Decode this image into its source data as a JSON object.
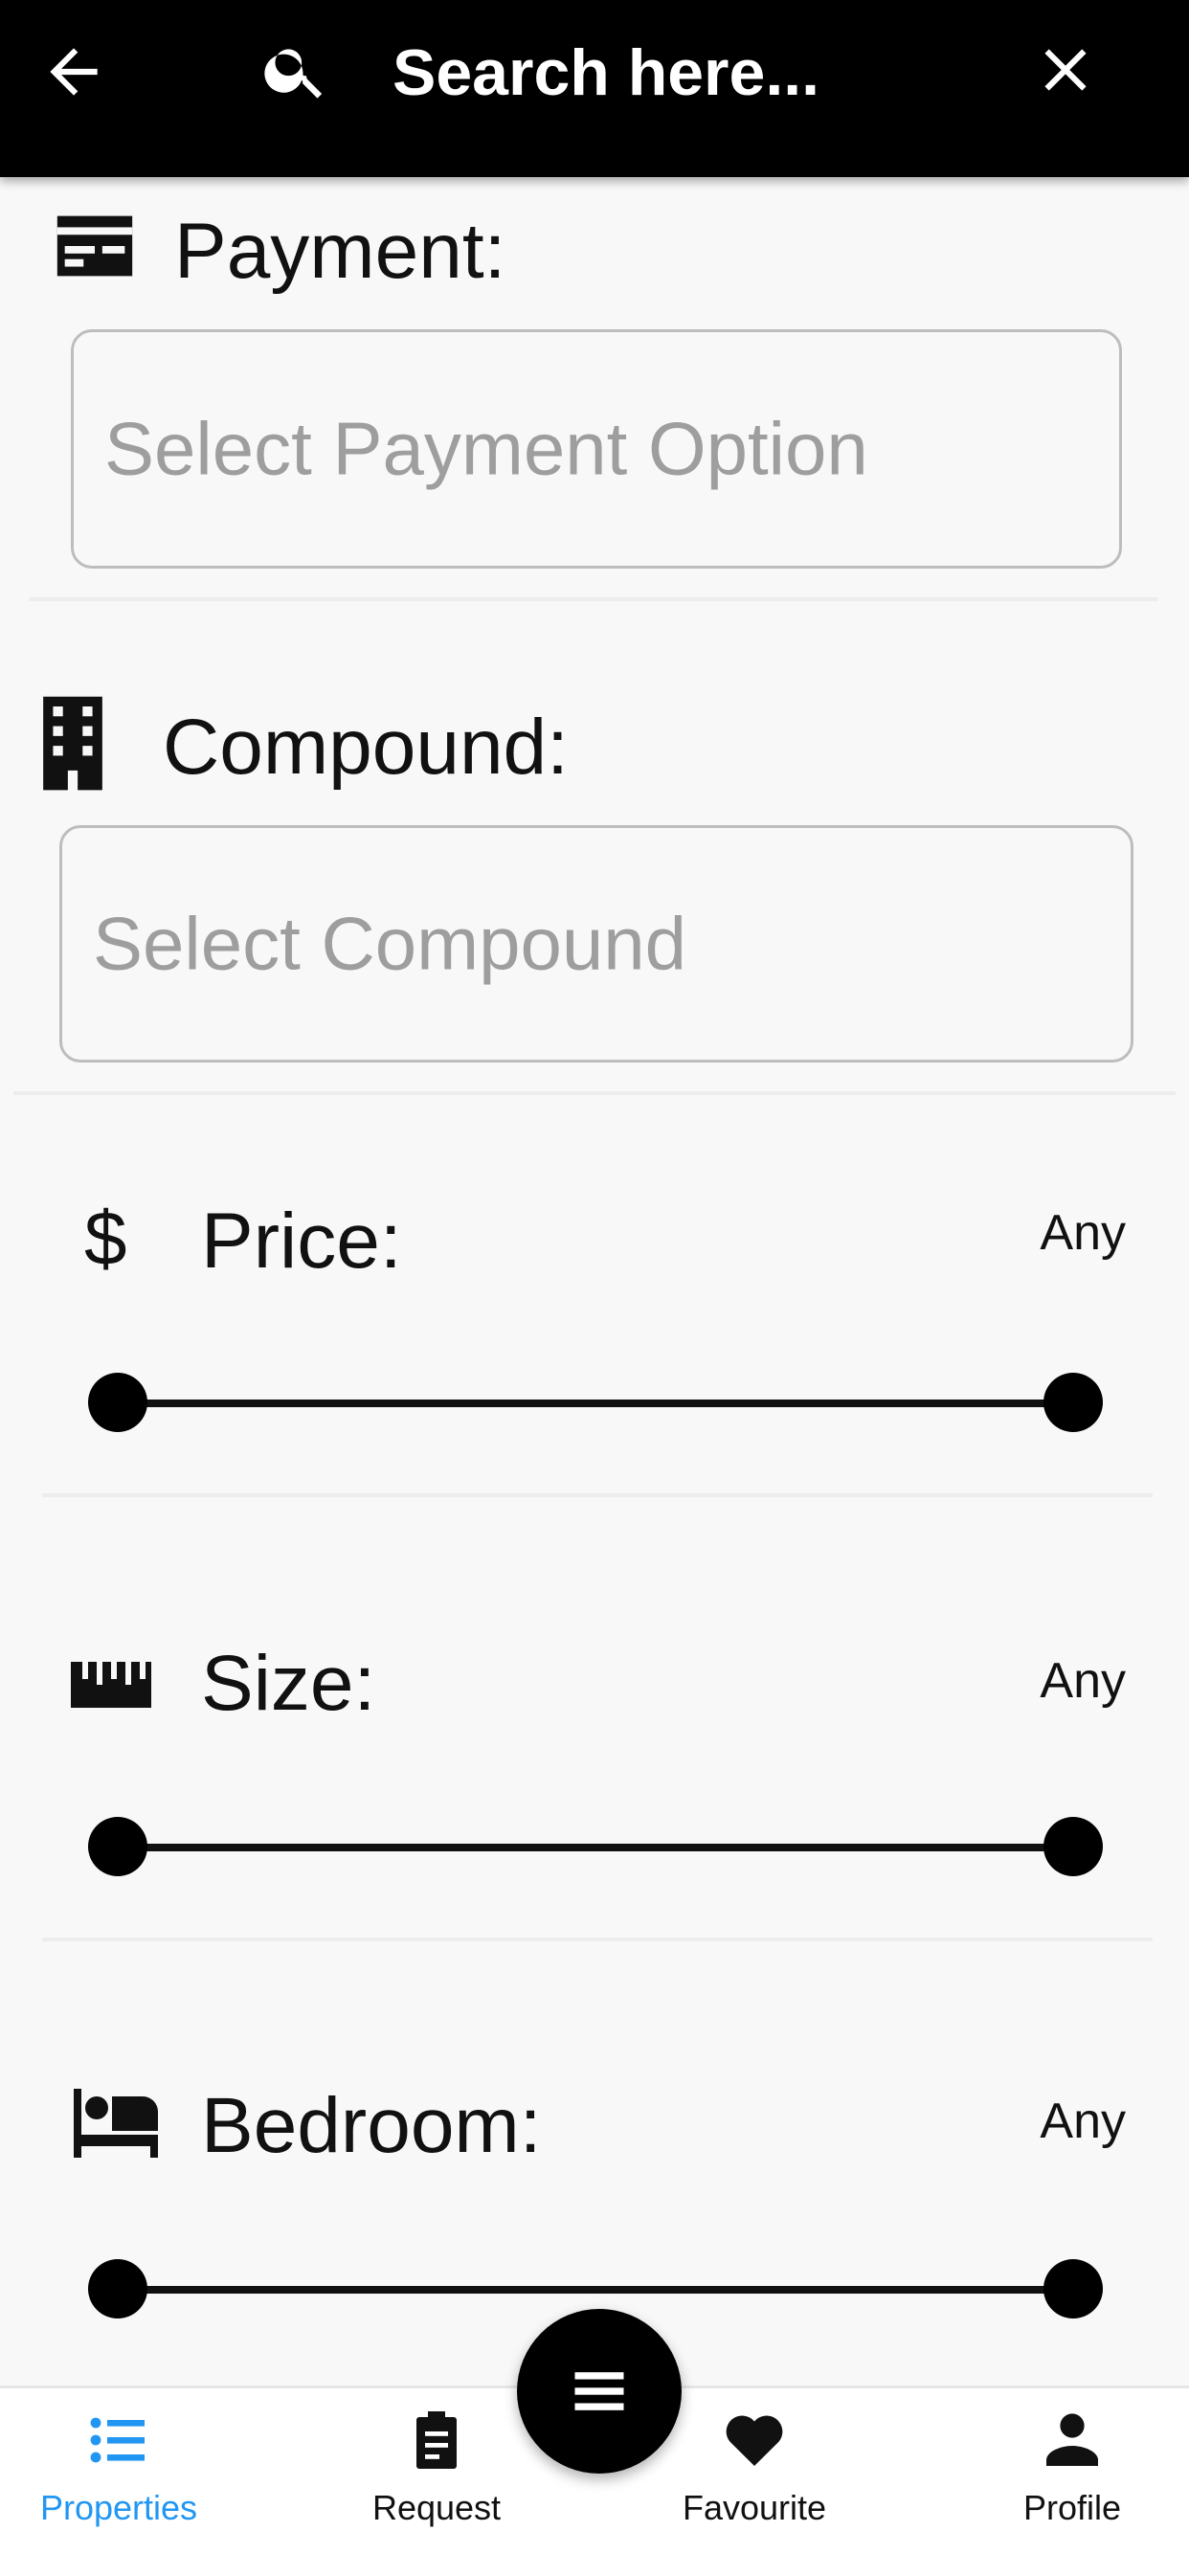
{
  "search": {
    "placeholder": "Search here..."
  },
  "filters": {
    "payment": {
      "label": "Payment:",
      "placeholder": "Select Payment Option"
    },
    "compound": {
      "label": "Compound:",
      "placeholder": "Select Compound"
    },
    "price": {
      "label": "Price:",
      "value": "Any"
    },
    "size": {
      "label": "Size:",
      "value": "Any"
    },
    "bedroom": {
      "label": "Bedroom:",
      "value": "Any"
    }
  },
  "nav": {
    "items": [
      {
        "label": "Properties",
        "icon": "list-icon",
        "active": true
      },
      {
        "label": "Request",
        "icon": "clipboard-icon",
        "active": false
      },
      {
        "label": "Favourite",
        "icon": "heart-icon",
        "active": false
      },
      {
        "label": "Profile",
        "icon": "person-icon",
        "active": false
      }
    ],
    "fab_icon": "menu-icon"
  },
  "colors": {
    "accent": "#2196f3",
    "topbar": "#000000",
    "background": "#f8f8f8"
  }
}
